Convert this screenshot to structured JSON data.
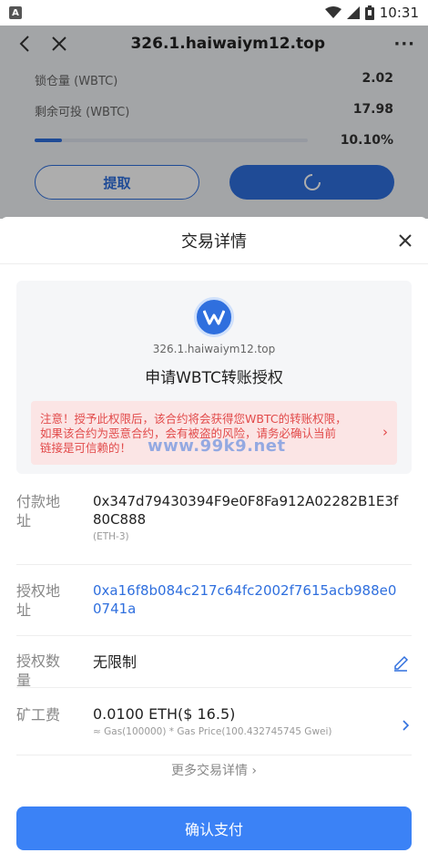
{
  "status_bar": {
    "time": "10:31",
    "app_badge": "A"
  },
  "nav": {
    "title": "326.1.haiwaiym12.top",
    "more": "···"
  },
  "background": {
    "locked_label": "锁仓量 (WBTC)",
    "locked_value": "2.02",
    "remaining_label": "剩余可投 (WBTC)",
    "remaining_value": "17.98",
    "progress_percent": "10.10%",
    "progress_fraction": 0.1,
    "withdraw_label": "提取"
  },
  "sheet": {
    "title": "交易详情",
    "domain": "326.1.haiwaiym12.top",
    "request_title": "申请WBTC转账授权",
    "warning_lines": [
      "注意！授予此权限后，该合约将会获得您WBTC的转账权限，",
      "如果该合约为恶意合约，会有被盗的风险，请务必确认当前",
      "链接是可信赖的！"
    ],
    "watermark": "www.99k9.net",
    "payer_label": "付款地址",
    "payer_value": "0x347d79430394F9e0F8Fa912A02282B1E3f80C888",
    "payer_network": "(ETH-3)",
    "auth_addr_label": "授权地址",
    "auth_addr_value": "0xa16f8b084c217c64fc2002f7615acb988e00741a",
    "auth_amount_label": "授权数量",
    "auth_amount_value": "无限制",
    "fee_label": "矿工费",
    "fee_value": "0.0100 ETH($ 16.5)",
    "fee_detail": "≈ Gas(100000) * Gas Price(100.432745745 Gwei)",
    "more_details": "更多交易详情 ›",
    "confirm_label": "确认支付"
  },
  "colors": {
    "accent": "#2f6fde",
    "button": "#3b82f6",
    "warning": "#e24a4a"
  }
}
